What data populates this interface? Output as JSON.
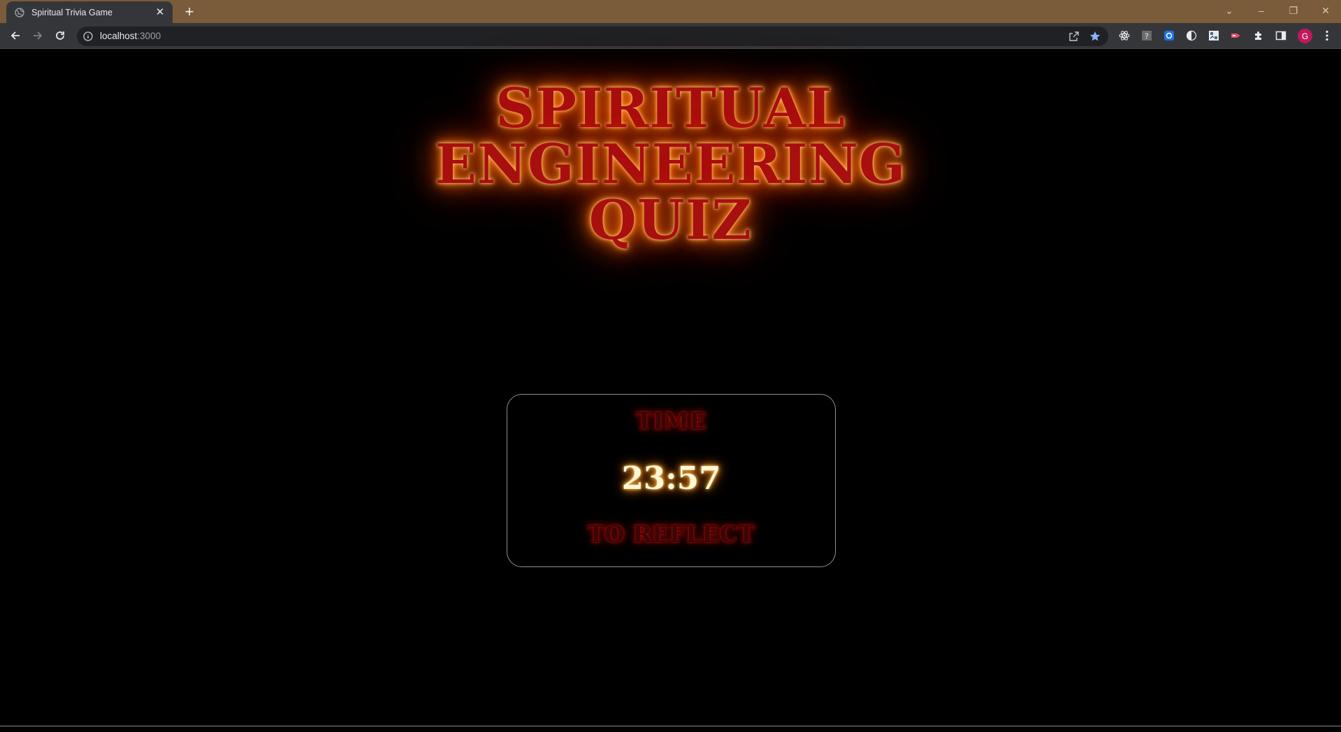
{
  "browser": {
    "tab_title": "Spiritual Trivia Game",
    "url_host": "localhost",
    "url_port": ":3000",
    "profile_initial": "G",
    "icons": {
      "favicon": "globe-icon",
      "close": "close-icon",
      "new_tab": "plus-icon",
      "back": "back-arrow-icon",
      "forward": "forward-arrow-icon",
      "reload": "reload-icon",
      "site_info": "info-icon",
      "share": "share-icon",
      "bookmark": "star-icon",
      "extensions": [
        "react-devtools-icon",
        "help-extension-icon",
        "blue-extension-icon",
        "contrast-extension-icon",
        "image-extension-icon",
        "red-extension-icon",
        "puzzle-icon"
      ],
      "side_panel": "side-panel-icon",
      "menu": "kebab-menu-icon"
    },
    "colors": {
      "tabstrip": "#7a5c3a",
      "toolbar": "#35363a",
      "omnibox": "#202124",
      "avatar": "#c2185b"
    }
  },
  "page": {
    "title_lines": [
      "SPIRITUAL",
      "ENGINEERING",
      "QUIZ"
    ],
    "timer": {
      "label_top": "TIME",
      "value": "23:57",
      "label_bottom": "TO REFLECT"
    },
    "colors": {
      "background": "#000000",
      "title_fill": "#a80f0f",
      "title_glow": "#ff6a00",
      "timer_value": "#fff7d6",
      "timer_border": "#8f8f8f"
    }
  }
}
